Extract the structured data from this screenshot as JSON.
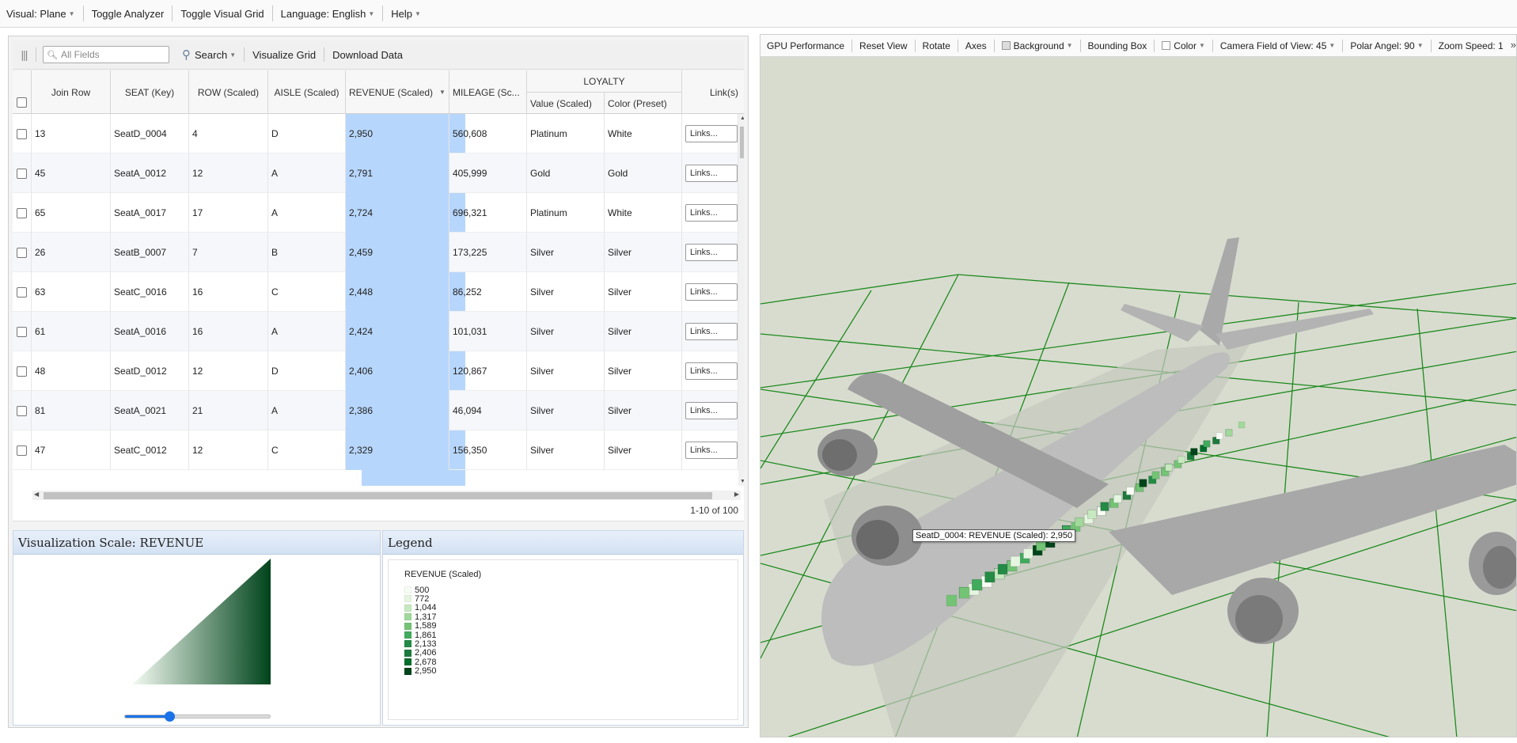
{
  "topmenu": {
    "visual": "Visual: Plane",
    "toggle_analyzer": "Toggle Analyzer",
    "toggle_visual_grid": "Toggle Visual Grid",
    "language": "Language: English",
    "help": "Help"
  },
  "grid_toolbar": {
    "search_placeholder": "All Fields",
    "search": "Search",
    "visualize_grid": "Visualize Grid",
    "download_data": "Download Data"
  },
  "columns": {
    "join_row": "Join Row",
    "seat": "SEAT (Key)",
    "row": "ROW (Scaled)",
    "aisle": "AISLE (Scaled)",
    "revenue": "REVENUE (Scaled)",
    "mileage": "MILEAGE (Sc...",
    "loyalty": "LOYALTY",
    "loyalty_value": "Value (Scaled)",
    "loyalty_color": "Color (Preset)",
    "links": "Link(s)"
  },
  "rows": [
    {
      "join": "13",
      "seat": "SeatD_0004",
      "row": "4",
      "aisle": "D",
      "revenue": "2,950",
      "mileage": "560,608",
      "value": "Platinum",
      "color": "White",
      "links": "Links..."
    },
    {
      "join": "45",
      "seat": "SeatA_0012",
      "row": "12",
      "aisle": "A",
      "revenue": "2,791",
      "mileage": "405,999",
      "value": "Gold",
      "color": "Gold",
      "links": "Links..."
    },
    {
      "join": "65",
      "seat": "SeatA_0017",
      "row": "17",
      "aisle": "A",
      "revenue": "2,724",
      "mileage": "696,321",
      "value": "Platinum",
      "color": "White",
      "links": "Links..."
    },
    {
      "join": "26",
      "seat": "SeatB_0007",
      "row": "7",
      "aisle": "B",
      "revenue": "2,459",
      "mileage": "173,225",
      "value": "Silver",
      "color": "Silver",
      "links": "Links..."
    },
    {
      "join": "63",
      "seat": "SeatC_0016",
      "row": "16",
      "aisle": "C",
      "revenue": "2,448",
      "mileage": "86,252",
      "value": "Silver",
      "color": "Silver",
      "links": "Links..."
    },
    {
      "join": "61",
      "seat": "SeatA_0016",
      "row": "16",
      "aisle": "A",
      "revenue": "2,424",
      "mileage": "101,031",
      "value": "Silver",
      "color": "Silver",
      "links": "Links..."
    },
    {
      "join": "48",
      "seat": "SeatD_0012",
      "row": "12",
      "aisle": "D",
      "revenue": "2,406",
      "mileage": "120,867",
      "value": "Silver",
      "color": "Silver",
      "links": "Links..."
    },
    {
      "join": "81",
      "seat": "SeatA_0021",
      "row": "21",
      "aisle": "A",
      "revenue": "2,386",
      "mileage": "46,094",
      "value": "Silver",
      "color": "Silver",
      "links": "Links..."
    },
    {
      "join": "47",
      "seat": "SeatC_0012",
      "row": "12",
      "aisle": "C",
      "revenue": "2,329",
      "mileage": "156,350",
      "value": "Silver",
      "color": "Silver",
      "links": "Links..."
    }
  ],
  "pager": "1-10 of 100",
  "vis_scale": {
    "title": "Visualization Scale: REVENUE",
    "slider_value": 0.31,
    "gradient_from": "#f4fbf2",
    "gradient_to": "#00441b"
  },
  "legend": {
    "title": "Legend",
    "field": "REVENUE (Scaled)",
    "items": [
      {
        "label": "500",
        "color": "#f7fcf5"
      },
      {
        "label": "772",
        "color": "#e5f5e0"
      },
      {
        "label": "1,044",
        "color": "#c7e9c0"
      },
      {
        "label": "1,317",
        "color": "#a1d99b"
      },
      {
        "label": "1,589",
        "color": "#74c476"
      },
      {
        "label": "1,861",
        "color": "#41ab5d"
      },
      {
        "label": "2,133",
        "color": "#238b45"
      },
      {
        "label": "2,406",
        "color": "#1b7a3c"
      },
      {
        "label": "2,678",
        "color": "#006d2c"
      },
      {
        "label": "2,950",
        "color": "#00441b"
      }
    ]
  },
  "view_toolbar": {
    "gpu": "GPU Performance",
    "reset": "Reset View",
    "rotate": "Rotate",
    "axes": "Axes",
    "background": "Background",
    "bbox": "Bounding Box",
    "color": "Color",
    "fov": "Camera Field of View: 45",
    "polar": "Polar Angel: 90",
    "zoom": "Zoom Speed: 1"
  },
  "tooltip": "SeatD_0004: REVENUE (Scaled): 2,950",
  "colors": {
    "accent": "#1a73e8",
    "selected_column": "#b7d6fb",
    "grid_line": "#1e8a1e",
    "scene_background": "#d8dccf"
  }
}
